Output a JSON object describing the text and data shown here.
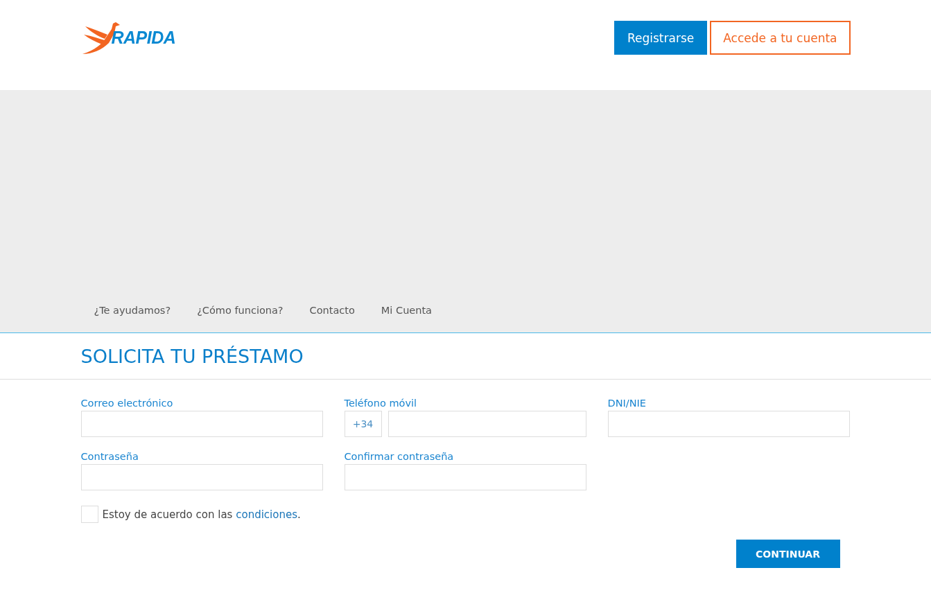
{
  "header": {
    "logo_text": "RAPIDA",
    "buttons": [
      {
        "label": "Registrarse",
        "kind": "primary"
      },
      {
        "label": "Accede a tu cuenta",
        "kind": "outline"
      }
    ]
  },
  "nav": {
    "items": [
      "¿Te ayudamos?",
      "¿Cómo funciona?",
      "Contacto",
      "Mi Cuenta"
    ]
  },
  "title": "SOLICITA TU PRÉSTAMO",
  "form": {
    "fields": [
      {
        "label": "Correo electrónico",
        "kind": "text"
      },
      {
        "label": "Teléfono móvil",
        "kind": "phone",
        "prefix": "+34"
      },
      {
        "label": "DNI/NIE",
        "kind": "text"
      },
      {
        "label": "Contraseña",
        "kind": "text"
      },
      {
        "label": "Confirmar contraseña",
        "kind": "text"
      }
    ],
    "agree": {
      "text": "Estoy de acuerdo con las ",
      "link": "condiciones",
      "after": ".",
      "checked": false
    },
    "submit": "CONTINUAR"
  }
}
